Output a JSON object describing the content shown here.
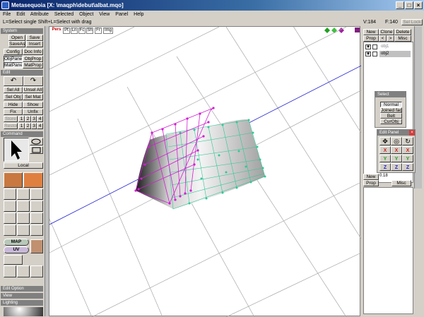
{
  "window": {
    "title": "Metasequoia [X: \\maqph\\debut\\albat.mqo]"
  },
  "menu": [
    "File",
    "Edit",
    "Attribute",
    "Selected",
    "Object",
    "View",
    "Panel",
    "Help"
  ],
  "hint": "L=Select single  Shift+L=Select with drag",
  "status": {
    "vertices": "V:184",
    "faces": "F:140",
    "sellock": "Sel Lock"
  },
  "system": {
    "header": "System",
    "buttons": [
      "Open",
      "Save",
      "SaveAs",
      "Insert",
      "Config",
      "Doc Info",
      "ObjPanel",
      "ObjProp",
      "MatPanel",
      "MatProp"
    ]
  },
  "edit": {
    "header": "Edit",
    "buttons": [
      "Sel All",
      "Unsel All",
      "Sel Obj",
      "Sel Mat",
      "Hide",
      "Show",
      "Fix",
      "Unfix",
      "Store",
      "Restore"
    ],
    "numbers": [
      "1",
      "2",
      "3",
      "4"
    ]
  },
  "command": {
    "header": "Command",
    "local": "Local"
  },
  "tool_labels": {
    "map": "MAP",
    "uv": "UV"
  },
  "bottom_sections": [
    "Edit Option",
    "View",
    "Lighting"
  ],
  "viewport": {
    "tabs": [
      "Pers",
      "Pt",
      "Ln",
      "Fc",
      "Sh",
      "Fr",
      "Img"
    ]
  },
  "objects": {
    "buttons": [
      "New",
      "Clone",
      "Delete",
      "Prop",
      "<",
      ">",
      "Misc"
    ],
    "items": [
      "obj1",
      "obj2"
    ]
  },
  "select_panel": {
    "title": "Select",
    "buttons": [
      "Normal",
      "Joined face",
      "Belt",
      "CurObj"
    ]
  },
  "edit_panel": {
    "title": "Edit Panel",
    "axes": [
      "X",
      "X",
      "X",
      "Y",
      "Y",
      "Y",
      "Z",
      "Z",
      "Z"
    ]
  },
  "material": {
    "buttons": [
      "New",
      "Prop",
      "Misc"
    ],
    "value": "0.18"
  }
}
